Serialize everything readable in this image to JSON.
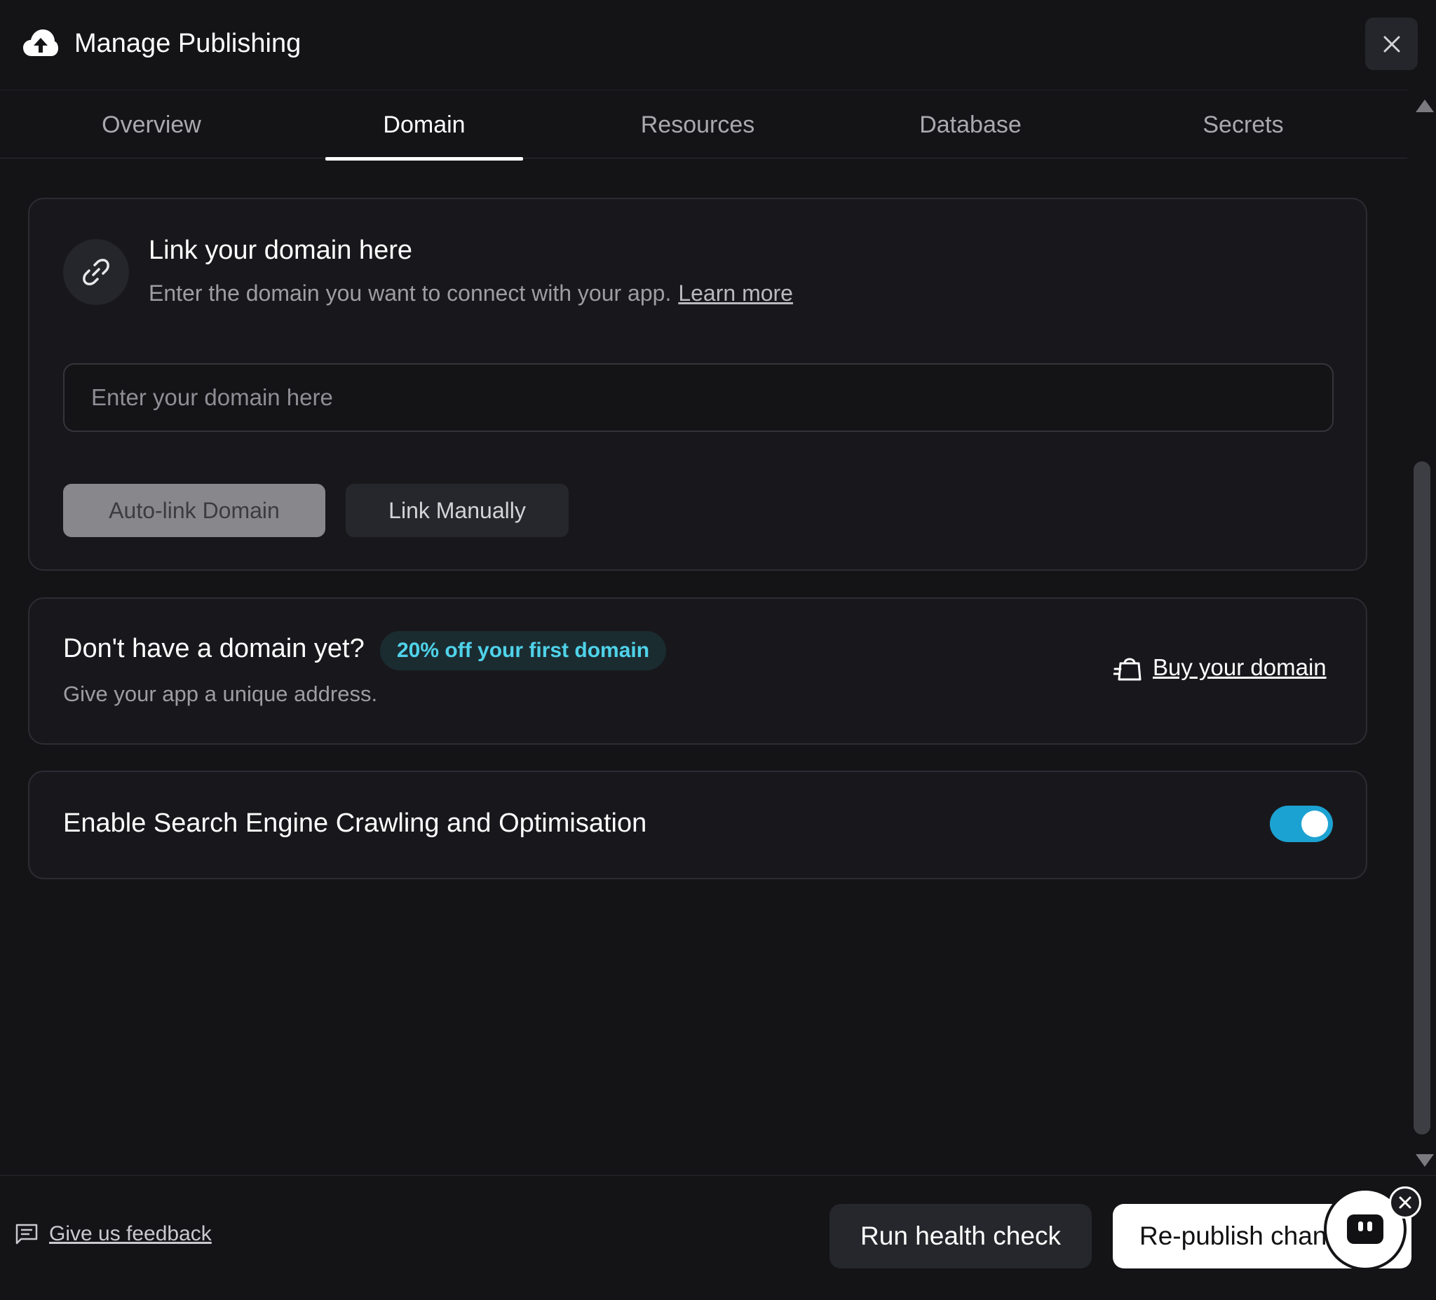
{
  "header": {
    "title": "Manage Publishing",
    "icon": "cloud-upload-icon",
    "close_icon": "close-icon"
  },
  "tabs": [
    {
      "label": "Overview",
      "active": false
    },
    {
      "label": "Domain",
      "active": true
    },
    {
      "label": "Resources",
      "active": false
    },
    {
      "label": "Database",
      "active": false
    },
    {
      "label": "Secrets",
      "active": false
    }
  ],
  "link_domain": {
    "icon": "link-icon",
    "title": "Link your domain here",
    "description": "Enter the domain you want to connect with your app.",
    "learn_more": "Learn more",
    "input_placeholder": "Enter your domain here",
    "input_value": "",
    "auto_link_label": "Auto-link Domain",
    "link_manually_label": "Link Manually"
  },
  "buy_domain": {
    "title": "Don't have a domain yet?",
    "badge": "20% off your first domain",
    "description": "Give your app a unique address.",
    "buy_label": "Buy your domain",
    "buy_icon": "shopping-bag-icon"
  },
  "seo": {
    "label": "Enable Search Engine Crawling and Optimisation",
    "enabled": true
  },
  "footer": {
    "feedback_label": "Give us feedback",
    "feedback_icon": "message-icon",
    "health_check_label": "Run health check",
    "republish_label": "Re-publish changes",
    "assistant_icon": "assistant-bot-icon",
    "assistant_close_icon": "close-icon"
  },
  "colors": {
    "background": "#141417",
    "card": "#18181c",
    "accent": "#1ca2d2",
    "badge_text": "#4fd3ea"
  }
}
